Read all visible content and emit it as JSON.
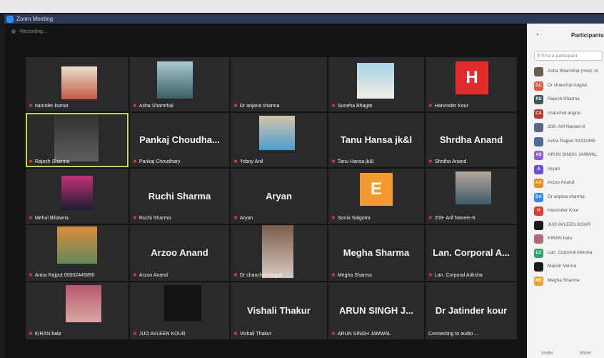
{
  "window": {
    "title": "Zoom Meeting"
  },
  "status": {
    "recording": "Recording..."
  },
  "tiles": [
    {
      "name": "narinder kumar"
    },
    {
      "name": "Asha Sharmhal"
    },
    {
      "name": "Dr anjana sharma"
    },
    {
      "name": "Suneha Bhagat"
    },
    {
      "name": "Harvinder Kour",
      "letter": "H"
    },
    {
      "name": "Rajesh Sharma"
    },
    {
      "name": "Pankaj Choudhary",
      "big": "Pankaj Choudha..."
    },
    {
      "name": "Yoboy Anil"
    },
    {
      "name": "Tanu Hansa jk&l",
      "big": "Tanu Hansa jk&l"
    },
    {
      "name": "Shrdha Anand",
      "big": "Shrdha Anand"
    },
    {
      "name": "Mehul Billawria"
    },
    {
      "name": "Ruchi Sharma",
      "big": "Ruchi Sharma"
    },
    {
      "name": "Aryan",
      "big": "Aryan"
    },
    {
      "name": "Sonia Salgotra",
      "letter": "E"
    },
    {
      "name": "209- Arif Naseer-8"
    },
    {
      "name": "Antra Rajput 00002445890"
    },
    {
      "name": "Arzoo Anand",
      "big": "Arzoo Anand"
    },
    {
      "name": "Dr chanchal Angral"
    },
    {
      "name": "Megha Sharma",
      "big": "Megha Sharma"
    },
    {
      "name": "Lan. Corporal Atiksha",
      "big": "Lan. Corporal A..."
    },
    {
      "name": "KIRAN bala"
    },
    {
      "name": "JUO AVLEEN KOUR"
    },
    {
      "name": "Vishali Thakur",
      "big": "Vishali Thakur"
    },
    {
      "name": "ARUN SINGH JAMWAL",
      "big": "ARUN SINGH J..."
    },
    {
      "name": "Connecting to audio ...",
      "big": "Dr Jatinder kour"
    }
  ],
  "sidebar": {
    "title": "Participants",
    "search_placeholder": "Find a participant",
    "participants": [
      {
        "initials": "",
        "name": "Asha Sharmhal (Host, m",
        "color": "#6b5a4e"
      },
      {
        "initials": "DC",
        "name": "Dr chanchal Angral",
        "color": "#e3583f"
      },
      {
        "initials": "RS",
        "name": "Rajesh Sharma",
        "color": "#3a5a50"
      },
      {
        "initials": "CA",
        "name": "chanchal angral",
        "color": "#c0392b"
      },
      {
        "initials": "",
        "name": "209- Arif Naseer-8",
        "color": "#5a6a7a"
      },
      {
        "initials": "",
        "name": "Antra Rajput 00002445",
        "color": "#4a6a9a"
      },
      {
        "initials": "AS",
        "name": "ARUN SINGH JAMWAL",
        "color": "#8e5bd1"
      },
      {
        "initials": "A",
        "name": "Aryan",
        "color": "#6b4fd1"
      },
      {
        "initials": "AA",
        "name": "Arzoo Anand",
        "color": "#f08a1c"
      },
      {
        "initials": "DA",
        "name": "Dr anjana sharma",
        "color": "#2d8cff"
      },
      {
        "initials": "H",
        "name": "Harvinder Kour",
        "color": "#e03b2b"
      },
      {
        "initials": "",
        "name": "JUO AVLEEN KOUR",
        "color": "#1a1a1a"
      },
      {
        "initials": "",
        "name": "KIRAN bala",
        "color": "#b06a7a"
      },
      {
        "initials": "LC",
        "name": "Lan. Corporal Atiksha",
        "color": "#2fa36b"
      },
      {
        "initials": "",
        "name": "Manvir Verma",
        "color": "#1a1a1a"
      },
      {
        "initials": "MS",
        "name": "Megha Sharma",
        "color": "#f0a020"
      }
    ],
    "footer": {
      "invite": "Invite",
      "more": "More"
    }
  }
}
